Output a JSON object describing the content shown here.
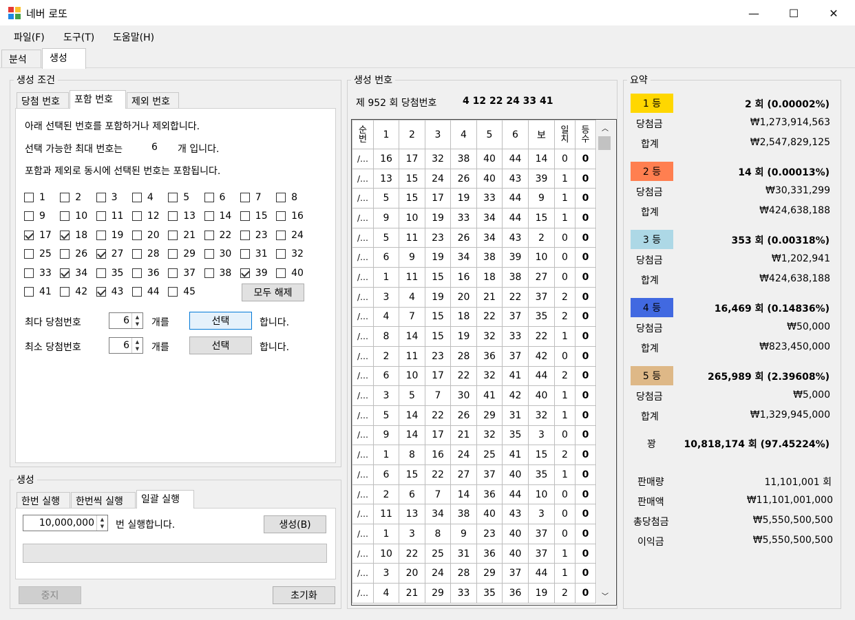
{
  "window": {
    "title": "네버 로또",
    "min": "—",
    "max": "☐",
    "close": "✕"
  },
  "menu": [
    "파일(F)",
    "도구(T)",
    "도움말(H)"
  ],
  "tabs": [
    "분석",
    "생성"
  ],
  "conditions": {
    "title": "생성 조건",
    "subtabs": [
      "당첨 번호",
      "포함 번호",
      "제외 번호"
    ],
    "info1": "아래 선택된 번호를 포함하거나 제외합니다.",
    "info2_a": "선택 가능한 최대 번호는",
    "info2_n": "6",
    "info2_b": "개 입니다.",
    "info3": "포함과 제외로 동시에 선택된 번호는 포함됩니다.",
    "checked": [
      17,
      18,
      27,
      34,
      39,
      43
    ],
    "clear_all": "모두 해제",
    "max_label": "최다 당첨번호",
    "max_value": "6",
    "min_label": "최소 당첨번호",
    "min_value": "6",
    "count_unit": "개를",
    "select_btn": "선택",
    "suffix": "합니다."
  },
  "generate": {
    "title": "생성",
    "subtabs": [
      "한번 실행",
      "한번씩 실행",
      "일괄 실행"
    ],
    "count": "10,000,000",
    "count_suffix": "번 실행합니다.",
    "gen_btn": "생성(B)",
    "progress": 0,
    "stop_btn": "중지",
    "reset_btn": "초기화"
  },
  "numbers": {
    "title": "생성 번호",
    "draw_label": "제 952 회 당첨번호",
    "draw_numbers": "4 12 22 24 33 41",
    "headers": [
      "순번",
      "1",
      "2",
      "3",
      "4",
      "5",
      "6",
      "보",
      "일치",
      "등수"
    ],
    "rows": [
      [
        "/…",
        "16",
        "17",
        "32",
        "38",
        "40",
        "44",
        "14",
        "0",
        "0"
      ],
      [
        "/…",
        "13",
        "15",
        "24",
        "26",
        "40",
        "43",
        "39",
        "1",
        "0"
      ],
      [
        "/…",
        "5",
        "15",
        "17",
        "19",
        "33",
        "44",
        "9",
        "1",
        "0"
      ],
      [
        "/…",
        "9",
        "10",
        "19",
        "33",
        "34",
        "44",
        "15",
        "1",
        "0"
      ],
      [
        "/…",
        "5",
        "11",
        "23",
        "26",
        "34",
        "43",
        "2",
        "0",
        "0"
      ],
      [
        "/…",
        "6",
        "9",
        "19",
        "34",
        "38",
        "39",
        "10",
        "0",
        "0"
      ],
      [
        "/…",
        "1",
        "11",
        "15",
        "16",
        "18",
        "38",
        "27",
        "0",
        "0"
      ],
      [
        "/…",
        "3",
        "4",
        "19",
        "20",
        "21",
        "22",
        "37",
        "2",
        "0"
      ],
      [
        "/…",
        "4",
        "7",
        "15",
        "18",
        "22",
        "37",
        "35",
        "2",
        "0"
      ],
      [
        "/…",
        "8",
        "14",
        "15",
        "19",
        "32",
        "33",
        "22",
        "1",
        "0"
      ],
      [
        "/…",
        "2",
        "11",
        "23",
        "28",
        "36",
        "37",
        "42",
        "0",
        "0"
      ],
      [
        "/…",
        "6",
        "10",
        "17",
        "22",
        "32",
        "41",
        "44",
        "2",
        "0"
      ],
      [
        "/…",
        "3",
        "5",
        "7",
        "30",
        "41",
        "42",
        "40",
        "1",
        "0"
      ],
      [
        "/…",
        "5",
        "14",
        "22",
        "26",
        "29",
        "31",
        "32",
        "1",
        "0"
      ],
      [
        "/…",
        "9",
        "14",
        "17",
        "21",
        "32",
        "35",
        "3",
        "0",
        "0"
      ],
      [
        "/…",
        "1",
        "8",
        "16",
        "24",
        "25",
        "41",
        "15",
        "2",
        "0"
      ],
      [
        "/…",
        "6",
        "15",
        "22",
        "27",
        "37",
        "40",
        "35",
        "1",
        "0"
      ],
      [
        "/…",
        "2",
        "6",
        "7",
        "14",
        "36",
        "44",
        "10",
        "0",
        "0"
      ],
      [
        "/…",
        "11",
        "13",
        "34",
        "38",
        "40",
        "43",
        "3",
        "0",
        "0"
      ],
      [
        "/…",
        "1",
        "3",
        "8",
        "9",
        "23",
        "40",
        "37",
        "0",
        "0"
      ],
      [
        "/…",
        "10",
        "22",
        "25",
        "31",
        "36",
        "40",
        "37",
        "1",
        "0"
      ],
      [
        "/…",
        "3",
        "20",
        "24",
        "28",
        "29",
        "37",
        "44",
        "1",
        "0"
      ],
      [
        "/…",
        "4",
        "21",
        "29",
        "33",
        "35",
        "36",
        "19",
        "2",
        "0"
      ]
    ]
  },
  "summary": {
    "title": "요약",
    "ranks": [
      {
        "label": "1 등",
        "color": "#ffd700",
        "count": "2 회 (0.00002%)",
        "prize_label": "당첨금",
        "prize": "₩1,273,914,563",
        "total_label": "합계",
        "total": "₩2,547,829,125"
      },
      {
        "label": "2 등",
        "color": "#ff7f50",
        "count": "14 회 (0.00013%)",
        "prize_label": "당첨금",
        "prize": "₩30,331,299",
        "total_label": "합계",
        "total": "₩424,638,188"
      },
      {
        "label": "3 등",
        "color": "#add8e6",
        "count": "353 회 (0.00318%)",
        "prize_label": "당첨금",
        "prize": "₩1,202,941",
        "total_label": "합계",
        "total": "₩424,638,188"
      },
      {
        "label": "4 등",
        "color": "#4169e1",
        "count": "16,469 회 (0.14836%)",
        "prize_label": "당첨금",
        "prize": "₩50,000",
        "total_label": "합계",
        "total": "₩823,450,000"
      },
      {
        "label": "5 등",
        "color": "#deb887",
        "count": "265,989 회 (2.39608%)",
        "prize_label": "당첨금",
        "prize": "₩5,000",
        "total_label": "합계",
        "total": "₩1,329,945,000"
      }
    ],
    "miss_label": "꽝",
    "miss_count": "10,818,174 회 (97.45224%)",
    "sales_qty_label": "판매량",
    "sales_qty": "11,101,001 회",
    "sales_amt_label": "판매액",
    "sales_amt": "₩11,101,001,000",
    "total_prize_label": "총당첨금",
    "total_prize": "₩5,550,500,500",
    "profit_label": "이익금",
    "profit": "₩5,550,500,500"
  }
}
